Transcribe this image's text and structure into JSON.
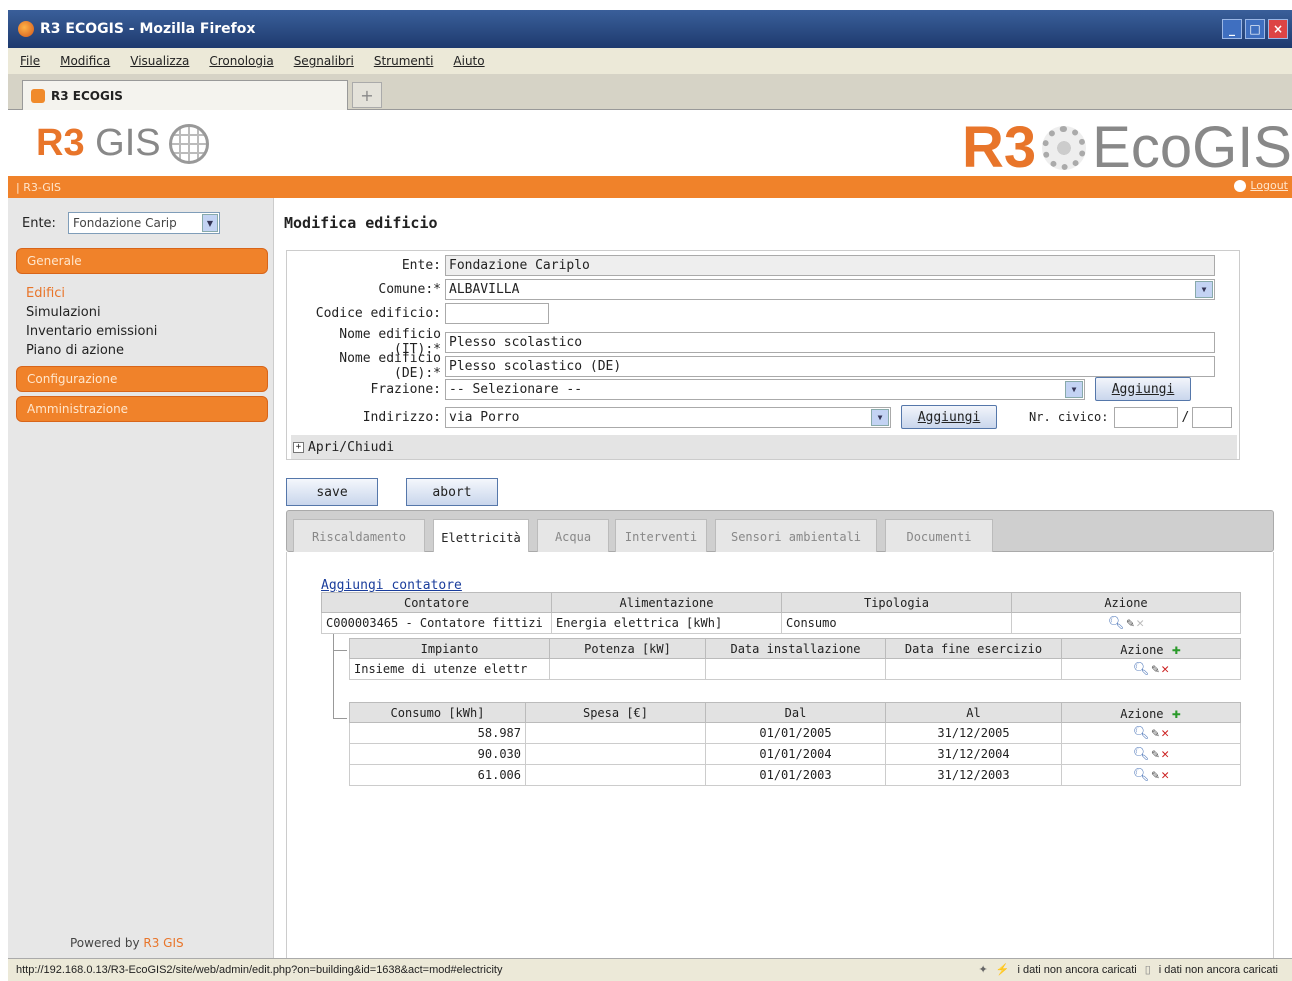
{
  "window": {
    "title": "R3 ECOGIS - Mozilla Firefox",
    "controls": [
      "_",
      "□",
      "×"
    ]
  },
  "menu": [
    "File",
    "Modifica",
    "Visualizza",
    "Cronologia",
    "Segnalibri",
    "Strumenti",
    "Aiuto"
  ],
  "browser_tab": {
    "label": "R3 ECOGIS",
    "new_tab": "+"
  },
  "header": {
    "logo_left_r3": "R3",
    "logo_left_gis": "GIS",
    "logo_right_r3": "R3",
    "logo_right_eco": "EcoGIS",
    "breadcrumb": "| R3-GIS",
    "logout": "Logout"
  },
  "sidebar": {
    "ente_label": "Ente:",
    "ente_value": "Fondazione Carip",
    "sections": [
      "Generale",
      "Configurazione",
      "Amministrazione"
    ],
    "links": [
      "Edifici",
      "Simulazioni",
      "Inventario emissioni",
      "Piano di azione"
    ],
    "powered_prefix": "Powered by ",
    "powered_brand": "R3 GIS"
  },
  "form": {
    "title": "Modifica edificio",
    "ente_label": "Ente:",
    "ente_value": "Fondazione Cariplo",
    "comune_label": "Comune:*",
    "comune_value": "ALBAVILLA",
    "codice_label": "Codice edificio:",
    "codice_value": "",
    "nome_it_label": "Nome edificio (IT):*",
    "nome_it_value": "Plesso scolastico",
    "nome_de_label": "Nome edificio (DE):*",
    "nome_de_value": "Plesso scolastico (DE)",
    "frazione_label": "Frazione:",
    "frazione_value": "-- Selezionare --",
    "indirizzo_label": "Indirizzo:",
    "indirizzo_value": "via Porro",
    "aggiungi": "Aggiungi",
    "civico_label": "Nr. civico:",
    "civico_sep": "/",
    "toggle": "Apri/Chiudi",
    "save": "save",
    "abort": "abort"
  },
  "tabs": [
    "Riscaldamento",
    "Elettricità",
    "Acqua",
    "Interventi",
    "Sensori ambientali",
    "Documenti"
  ],
  "content": {
    "add_link": "Aggiungi contatore",
    "meters_headers": [
      "Contatore",
      "Alimentazione",
      "Tipologia",
      "Azione"
    ],
    "meters_rows": [
      {
        "contatore": "C000003465 - Contatore fittizi",
        "alimentazione": "Energia elettrica [kWh]",
        "tipologia": "Consumo"
      }
    ],
    "plants_headers": [
      "Impianto",
      "Potenza [kW]",
      "Data installazione",
      "Data fine esercizio",
      "Azione"
    ],
    "plants_rows": [
      {
        "impianto": "Insieme di utenze elettr",
        "potenza": "",
        "installazione": "",
        "fine": ""
      }
    ],
    "consumption_headers": [
      "Consumo [kWh]",
      "Spesa [€]",
      "Dal",
      "Al",
      "Azione"
    ],
    "consumption_rows": [
      {
        "consumo": "58.987",
        "spesa": "",
        "dal": "01/01/2005",
        "al": "31/12/2005"
      },
      {
        "consumo": "90.030",
        "spesa": "",
        "dal": "01/01/2004",
        "al": "31/12/2004"
      },
      {
        "consumo": "61.006",
        "spesa": "",
        "dal": "01/01/2003",
        "al": "31/12/2003"
      }
    ]
  },
  "statusbar": {
    "url": "http://192.168.0.13/R3-EcoGIS2/site/web/admin/edit.php?on=building&id=1638&act=mod#electricity",
    "status1": "i dati non ancora caricati",
    "status2": "i dati non ancora caricati"
  },
  "colors": {
    "accent": "#f0822a",
    "link": "#1a3d9c"
  }
}
